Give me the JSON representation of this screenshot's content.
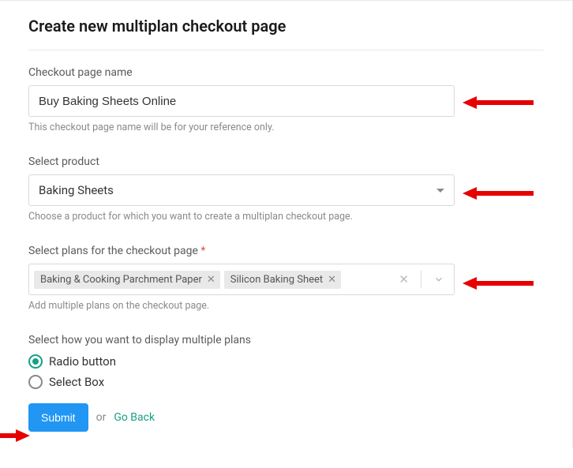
{
  "page_title": "Create new multiplan checkout page",
  "name_field": {
    "label": "Checkout page name",
    "value": "Buy Baking Sheets Online",
    "help": "This checkout page name will be for your reference only."
  },
  "product_field": {
    "label": "Select product",
    "value": "Baking Sheets",
    "help": "Choose a product for which you want to create a multiplan checkout page."
  },
  "plans_field": {
    "label": "Select plans for the checkout page",
    "required_marker": "*",
    "selected": [
      "Baking & Cooking Parchment Paper",
      "Silicon Baking Sheet"
    ],
    "help": "Add multiple plans on the checkout page."
  },
  "display_field": {
    "label": "Select how you want to display multiple plans",
    "options": [
      {
        "label": "Radio button",
        "selected": true
      },
      {
        "label": "Select Box",
        "selected": false
      }
    ]
  },
  "actions": {
    "submit": "Submit",
    "or": "or",
    "go_back": "Go Back"
  }
}
